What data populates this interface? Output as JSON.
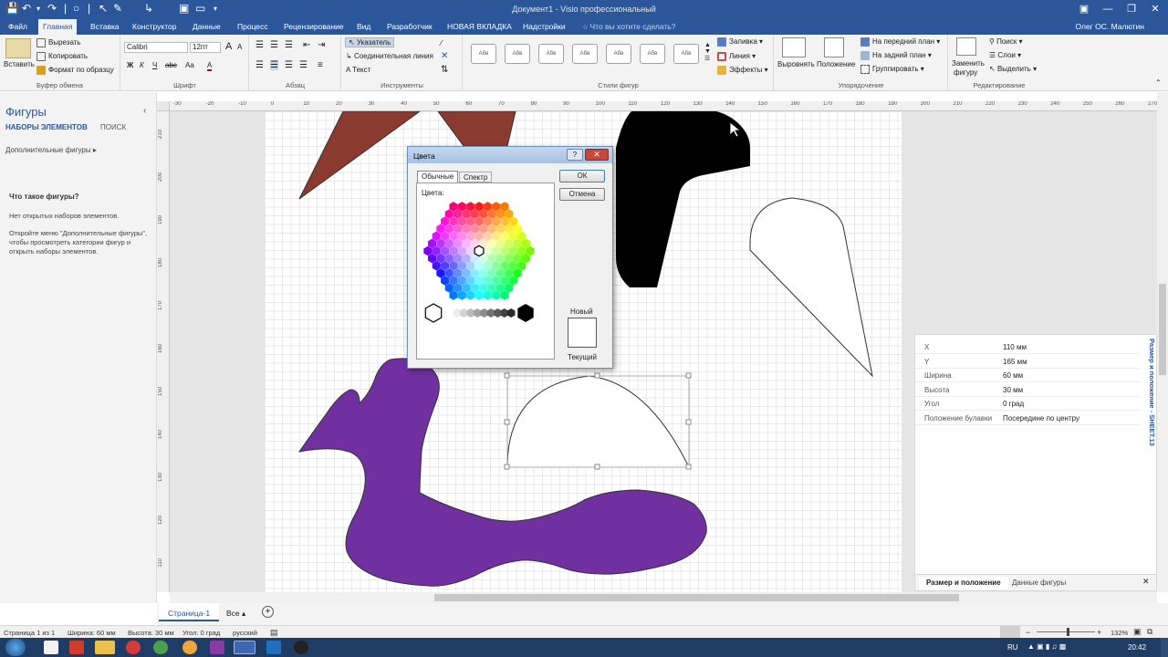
{
  "window": {
    "title": "Документ1 - Visio профессиональный",
    "user": "Олег ОС. Малютин"
  },
  "menu_tabs": [
    "Файл",
    "Главная",
    "Вставка",
    "Конструктор",
    "Данные",
    "Процесс",
    "Рецензирование",
    "Вид",
    "Разработчик",
    "НОВАЯ ВКЛАДКА",
    "Надстройки",
    "Что вы хотите сделать?"
  ],
  "ribbon": {
    "clipboard": {
      "paste": "Вставить",
      "cut": "Вырезать",
      "copy": "Копировать",
      "format_painter": "Формат по образцу",
      "label": "Буфер обмена"
    },
    "font": {
      "name": "Calibri",
      "size": "12пт",
      "bold": "Ж",
      "italic": "К",
      "underline": "Ч",
      "strike": "abc",
      "case": "Аа",
      "color_a": "A",
      "grow": "A",
      "shrink": "A",
      "label": "Шрифт"
    },
    "paragraph": {
      "label": "Абзац"
    },
    "tools": {
      "pointer": "Указатель",
      "connector": "Соединительная линия",
      "text": "Текст",
      "label": "Инструменты"
    },
    "styles": {
      "sample": "Абв",
      "fill": "Заливка",
      "line": "Линия",
      "effects": "Эффекты",
      "label": "Стили фигур"
    },
    "arrange": {
      "align": "Выровнять",
      "position": "Положение",
      "front": "На передний план",
      "back": "На задний план",
      "group": "Группировать",
      "label": "Упорядочение"
    },
    "editing": {
      "replace1": "Заменить",
      "replace2": "фигуру",
      "find": "Поиск",
      "layers": "Слои",
      "select": "Выделить",
      "label": "Редактирование"
    }
  },
  "shapes_pane": {
    "title": "Фигуры",
    "tab_sets": "НАБОРЫ ЭЛЕМЕНТОВ",
    "tab_search": "ПОИСК",
    "more_shapes": "Дополнительные фигуры",
    "info_title": "Что такое фигуры?",
    "info_1": "Нет открытых наборов элементов.",
    "info_2": "Откройте меню \"Дополнительные фигуры\", чтобы просмотреть категории фигур и открыть наборы элементов."
  },
  "ruler": {
    "h_ticks": [
      "-30",
      "-20",
      "-10",
      "0",
      "10",
      "20",
      "30",
      "40",
      "50",
      "60",
      "70",
      "80",
      "90",
      "100",
      "110",
      "120",
      "130",
      "140",
      "150",
      "160",
      "170",
      "180",
      "190",
      "200",
      "210",
      "220",
      "230",
      "240",
      "250",
      "260",
      "270"
    ],
    "v_ticks": [
      "210",
      "200",
      "190",
      "180",
      "170",
      "160",
      "150",
      "140",
      "130",
      "120",
      "110"
    ]
  },
  "color_dialog": {
    "title": "Цвета",
    "tab_standard": "Обычные",
    "tab_spectrum": "Спектр",
    "colors_label": "Цвета:",
    "ok": "ОК",
    "cancel": "Отмена",
    "new_label": "Новый",
    "current_label": "Текущий"
  },
  "size_panel": {
    "rows": [
      {
        "k": "X",
        "v": "110 мм"
      },
      {
        "k": "Y",
        "v": "165 мм"
      },
      {
        "k": "Ширина",
        "v": "60 мм"
      },
      {
        "k": "Высота",
        "v": "30 мм"
      },
      {
        "k": "Угол",
        "v": "0 град"
      },
      {
        "k": "Положение булавки",
        "v": "Посередине по центру"
      }
    ],
    "vertical_title": "Размер и положение - SHEET.13",
    "tab_size": "Размер и положение",
    "tab_data": "Данные фигуры"
  },
  "page_tabs": {
    "page": "Страница-1",
    "all": "Все"
  },
  "status": {
    "page": "Страница 1 из 1",
    "width": "Ширина: 60 мм",
    "height": "Высота: 30 мм",
    "angle": "Угол: 0 град",
    "lang": "русский",
    "zoom": "132%"
  },
  "taskbar": {
    "lang": "RU",
    "time": "20:42"
  },
  "colors": {
    "brown": "#8b3a2f",
    "black": "#000000",
    "purple": "#7030a0",
    "accent": "#2b579a"
  }
}
